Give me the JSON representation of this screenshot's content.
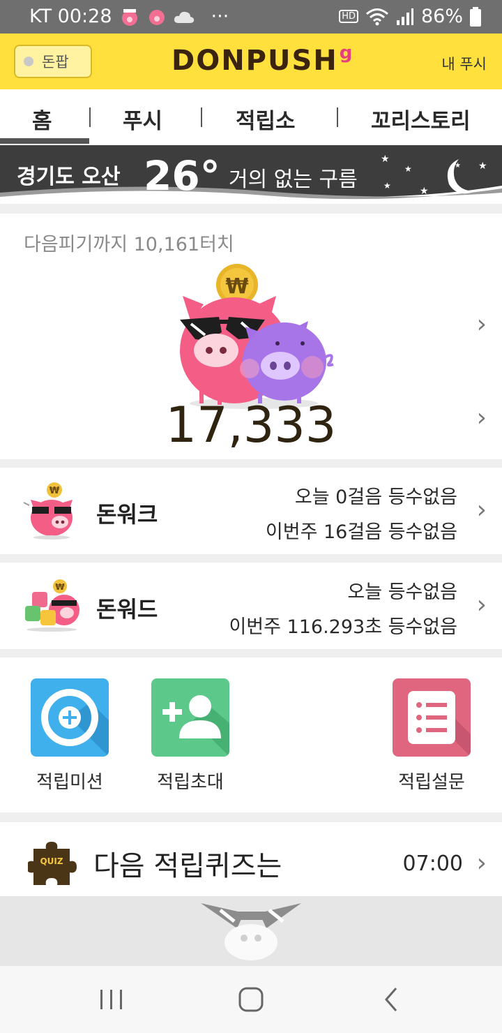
{
  "status_bar": {
    "carrier_time": "KT 00:28",
    "more": "···",
    "hd": "HD",
    "battery": "86%"
  },
  "header": {
    "donpap_label": "돈팝",
    "logo_text": "DONPUSH",
    "logo_g": "g",
    "my_push": "내 푸시"
  },
  "tabs": [
    "홈",
    "푸시",
    "적립소",
    "꼬리스토리"
  ],
  "weather": {
    "location": "경기도 오산",
    "temperature": "26°",
    "description": "거의 없는 구름"
  },
  "piggy": {
    "next_touch": "다음피기까지 10,161터치",
    "coin_symbol": "₩",
    "count": "17,333"
  },
  "donwalk": {
    "title": "돈워크",
    "line1": "오늘 0걸음 등수없음",
    "line2": "이번주 16걸음 등수없음"
  },
  "donword": {
    "title": "돈워드",
    "line1": "오늘 등수없음",
    "line2": "이번주 116.293초 등수없음"
  },
  "shortcuts": [
    {
      "label": "적립미션",
      "icon": "plus-circle-icon",
      "color": "#3fb0ec"
    },
    {
      "label": "적립초대",
      "icon": "add-user-icon",
      "color": "#5cc98a"
    },
    {
      "label": "적립설문",
      "icon": "survey-list-icon",
      "color": "#e0667f"
    }
  ],
  "quiz": {
    "badge": "QUIZ",
    "title": "다음 적립퀴즈는",
    "time": "07:00"
  },
  "colors": {
    "header_yellow": "#ffe03c",
    "weather_bg": "#3d3d3d",
    "pig_pink": "#f2587d",
    "pig_purple": "#a875e8"
  }
}
